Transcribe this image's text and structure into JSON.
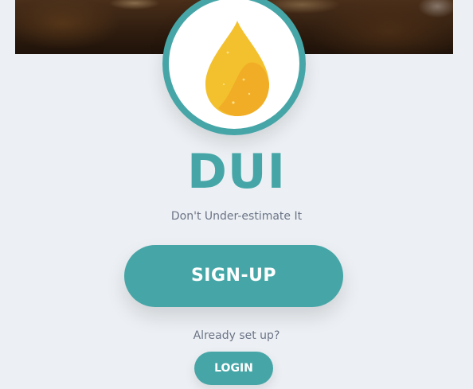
{
  "brand": {
    "title": "DUI",
    "tagline": "Don't Under-estimate It",
    "logo_icon": "oil-drop-icon"
  },
  "actions": {
    "signup_label": "SIGN-UP",
    "already_text": "Already set up?",
    "login_label": "LOGIN"
  },
  "colors": {
    "accent": "#46a6a7",
    "background": "#ecf0f4",
    "drop_light": "#f2c12e",
    "drop_dark": "#f1ad26",
    "muted_text": "#6c7486"
  }
}
